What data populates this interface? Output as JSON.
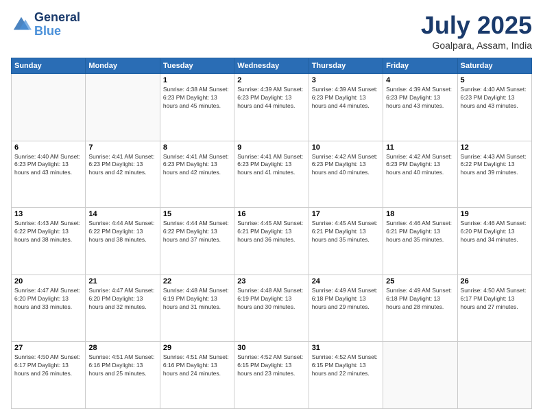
{
  "header": {
    "logo_line1": "General",
    "logo_line2": "Blue",
    "month": "July 2025",
    "location": "Goalpara, Assam, India"
  },
  "days_of_week": [
    "Sunday",
    "Monday",
    "Tuesday",
    "Wednesday",
    "Thursday",
    "Friday",
    "Saturday"
  ],
  "weeks": [
    [
      {
        "day": "",
        "info": ""
      },
      {
        "day": "",
        "info": ""
      },
      {
        "day": "1",
        "info": "Sunrise: 4:38 AM\nSunset: 6:23 PM\nDaylight: 13 hours and 45 minutes."
      },
      {
        "day": "2",
        "info": "Sunrise: 4:39 AM\nSunset: 6:23 PM\nDaylight: 13 hours and 44 minutes."
      },
      {
        "day": "3",
        "info": "Sunrise: 4:39 AM\nSunset: 6:23 PM\nDaylight: 13 hours and 44 minutes."
      },
      {
        "day": "4",
        "info": "Sunrise: 4:39 AM\nSunset: 6:23 PM\nDaylight: 13 hours and 43 minutes."
      },
      {
        "day": "5",
        "info": "Sunrise: 4:40 AM\nSunset: 6:23 PM\nDaylight: 13 hours and 43 minutes."
      }
    ],
    [
      {
        "day": "6",
        "info": "Sunrise: 4:40 AM\nSunset: 6:23 PM\nDaylight: 13 hours and 43 minutes."
      },
      {
        "day": "7",
        "info": "Sunrise: 4:41 AM\nSunset: 6:23 PM\nDaylight: 13 hours and 42 minutes."
      },
      {
        "day": "8",
        "info": "Sunrise: 4:41 AM\nSunset: 6:23 PM\nDaylight: 13 hours and 42 minutes."
      },
      {
        "day": "9",
        "info": "Sunrise: 4:41 AM\nSunset: 6:23 PM\nDaylight: 13 hours and 41 minutes."
      },
      {
        "day": "10",
        "info": "Sunrise: 4:42 AM\nSunset: 6:23 PM\nDaylight: 13 hours and 40 minutes."
      },
      {
        "day": "11",
        "info": "Sunrise: 4:42 AM\nSunset: 6:23 PM\nDaylight: 13 hours and 40 minutes."
      },
      {
        "day": "12",
        "info": "Sunrise: 4:43 AM\nSunset: 6:22 PM\nDaylight: 13 hours and 39 minutes."
      }
    ],
    [
      {
        "day": "13",
        "info": "Sunrise: 4:43 AM\nSunset: 6:22 PM\nDaylight: 13 hours and 38 minutes."
      },
      {
        "day": "14",
        "info": "Sunrise: 4:44 AM\nSunset: 6:22 PM\nDaylight: 13 hours and 38 minutes."
      },
      {
        "day": "15",
        "info": "Sunrise: 4:44 AM\nSunset: 6:22 PM\nDaylight: 13 hours and 37 minutes."
      },
      {
        "day": "16",
        "info": "Sunrise: 4:45 AM\nSunset: 6:21 PM\nDaylight: 13 hours and 36 minutes."
      },
      {
        "day": "17",
        "info": "Sunrise: 4:45 AM\nSunset: 6:21 PM\nDaylight: 13 hours and 35 minutes."
      },
      {
        "day": "18",
        "info": "Sunrise: 4:46 AM\nSunset: 6:21 PM\nDaylight: 13 hours and 35 minutes."
      },
      {
        "day": "19",
        "info": "Sunrise: 4:46 AM\nSunset: 6:20 PM\nDaylight: 13 hours and 34 minutes."
      }
    ],
    [
      {
        "day": "20",
        "info": "Sunrise: 4:47 AM\nSunset: 6:20 PM\nDaylight: 13 hours and 33 minutes."
      },
      {
        "day": "21",
        "info": "Sunrise: 4:47 AM\nSunset: 6:20 PM\nDaylight: 13 hours and 32 minutes."
      },
      {
        "day": "22",
        "info": "Sunrise: 4:48 AM\nSunset: 6:19 PM\nDaylight: 13 hours and 31 minutes."
      },
      {
        "day": "23",
        "info": "Sunrise: 4:48 AM\nSunset: 6:19 PM\nDaylight: 13 hours and 30 minutes."
      },
      {
        "day": "24",
        "info": "Sunrise: 4:49 AM\nSunset: 6:18 PM\nDaylight: 13 hours and 29 minutes."
      },
      {
        "day": "25",
        "info": "Sunrise: 4:49 AM\nSunset: 6:18 PM\nDaylight: 13 hours and 28 minutes."
      },
      {
        "day": "26",
        "info": "Sunrise: 4:50 AM\nSunset: 6:17 PM\nDaylight: 13 hours and 27 minutes."
      }
    ],
    [
      {
        "day": "27",
        "info": "Sunrise: 4:50 AM\nSunset: 6:17 PM\nDaylight: 13 hours and 26 minutes."
      },
      {
        "day": "28",
        "info": "Sunrise: 4:51 AM\nSunset: 6:16 PM\nDaylight: 13 hours and 25 minutes."
      },
      {
        "day": "29",
        "info": "Sunrise: 4:51 AM\nSunset: 6:16 PM\nDaylight: 13 hours and 24 minutes."
      },
      {
        "day": "30",
        "info": "Sunrise: 4:52 AM\nSunset: 6:15 PM\nDaylight: 13 hours and 23 minutes."
      },
      {
        "day": "31",
        "info": "Sunrise: 4:52 AM\nSunset: 6:15 PM\nDaylight: 13 hours and 22 minutes."
      },
      {
        "day": "",
        "info": ""
      },
      {
        "day": "",
        "info": ""
      }
    ]
  ]
}
